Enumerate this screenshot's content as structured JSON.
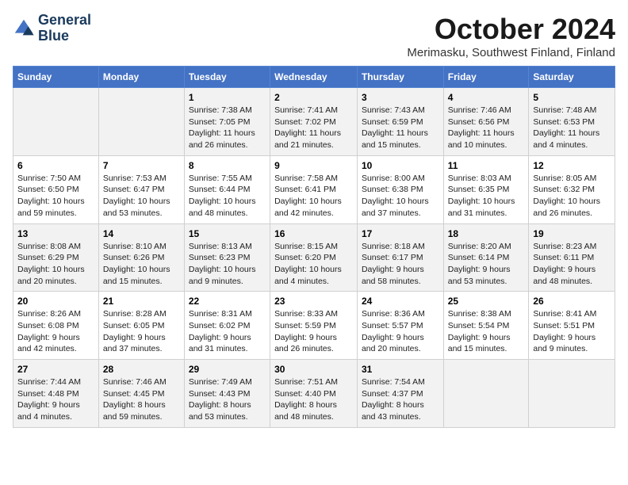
{
  "header": {
    "logo_line1": "General",
    "logo_line2": "Blue",
    "month_title": "October 2024",
    "location": "Merimasku, Southwest Finland, Finland"
  },
  "weekdays": [
    "Sunday",
    "Monday",
    "Tuesday",
    "Wednesday",
    "Thursday",
    "Friday",
    "Saturday"
  ],
  "weeks": [
    [
      {
        "day": "",
        "info": ""
      },
      {
        "day": "",
        "info": ""
      },
      {
        "day": "1",
        "info": "Sunrise: 7:38 AM\nSunset: 7:05 PM\nDaylight: 11 hours and 26 minutes."
      },
      {
        "day": "2",
        "info": "Sunrise: 7:41 AM\nSunset: 7:02 PM\nDaylight: 11 hours and 21 minutes."
      },
      {
        "day": "3",
        "info": "Sunrise: 7:43 AM\nSunset: 6:59 PM\nDaylight: 11 hours and 15 minutes."
      },
      {
        "day": "4",
        "info": "Sunrise: 7:46 AM\nSunset: 6:56 PM\nDaylight: 11 hours and 10 minutes."
      },
      {
        "day": "5",
        "info": "Sunrise: 7:48 AM\nSunset: 6:53 PM\nDaylight: 11 hours and 4 minutes."
      }
    ],
    [
      {
        "day": "6",
        "info": "Sunrise: 7:50 AM\nSunset: 6:50 PM\nDaylight: 10 hours and 59 minutes."
      },
      {
        "day": "7",
        "info": "Sunrise: 7:53 AM\nSunset: 6:47 PM\nDaylight: 10 hours and 53 minutes."
      },
      {
        "day": "8",
        "info": "Sunrise: 7:55 AM\nSunset: 6:44 PM\nDaylight: 10 hours and 48 minutes."
      },
      {
        "day": "9",
        "info": "Sunrise: 7:58 AM\nSunset: 6:41 PM\nDaylight: 10 hours and 42 minutes."
      },
      {
        "day": "10",
        "info": "Sunrise: 8:00 AM\nSunset: 6:38 PM\nDaylight: 10 hours and 37 minutes."
      },
      {
        "day": "11",
        "info": "Sunrise: 8:03 AM\nSunset: 6:35 PM\nDaylight: 10 hours and 31 minutes."
      },
      {
        "day": "12",
        "info": "Sunrise: 8:05 AM\nSunset: 6:32 PM\nDaylight: 10 hours and 26 minutes."
      }
    ],
    [
      {
        "day": "13",
        "info": "Sunrise: 8:08 AM\nSunset: 6:29 PM\nDaylight: 10 hours and 20 minutes."
      },
      {
        "day": "14",
        "info": "Sunrise: 8:10 AM\nSunset: 6:26 PM\nDaylight: 10 hours and 15 minutes."
      },
      {
        "day": "15",
        "info": "Sunrise: 8:13 AM\nSunset: 6:23 PM\nDaylight: 10 hours and 9 minutes."
      },
      {
        "day": "16",
        "info": "Sunrise: 8:15 AM\nSunset: 6:20 PM\nDaylight: 10 hours and 4 minutes."
      },
      {
        "day": "17",
        "info": "Sunrise: 8:18 AM\nSunset: 6:17 PM\nDaylight: 9 hours and 58 minutes."
      },
      {
        "day": "18",
        "info": "Sunrise: 8:20 AM\nSunset: 6:14 PM\nDaylight: 9 hours and 53 minutes."
      },
      {
        "day": "19",
        "info": "Sunrise: 8:23 AM\nSunset: 6:11 PM\nDaylight: 9 hours and 48 minutes."
      }
    ],
    [
      {
        "day": "20",
        "info": "Sunrise: 8:26 AM\nSunset: 6:08 PM\nDaylight: 9 hours and 42 minutes."
      },
      {
        "day": "21",
        "info": "Sunrise: 8:28 AM\nSunset: 6:05 PM\nDaylight: 9 hours and 37 minutes."
      },
      {
        "day": "22",
        "info": "Sunrise: 8:31 AM\nSunset: 6:02 PM\nDaylight: 9 hours and 31 minutes."
      },
      {
        "day": "23",
        "info": "Sunrise: 8:33 AM\nSunset: 5:59 PM\nDaylight: 9 hours and 26 minutes."
      },
      {
        "day": "24",
        "info": "Sunrise: 8:36 AM\nSunset: 5:57 PM\nDaylight: 9 hours and 20 minutes."
      },
      {
        "day": "25",
        "info": "Sunrise: 8:38 AM\nSunset: 5:54 PM\nDaylight: 9 hours and 15 minutes."
      },
      {
        "day": "26",
        "info": "Sunrise: 8:41 AM\nSunset: 5:51 PM\nDaylight: 9 hours and 9 minutes."
      }
    ],
    [
      {
        "day": "27",
        "info": "Sunrise: 7:44 AM\nSunset: 4:48 PM\nDaylight: 9 hours and 4 minutes."
      },
      {
        "day": "28",
        "info": "Sunrise: 7:46 AM\nSunset: 4:45 PM\nDaylight: 8 hours and 59 minutes."
      },
      {
        "day": "29",
        "info": "Sunrise: 7:49 AM\nSunset: 4:43 PM\nDaylight: 8 hours and 53 minutes."
      },
      {
        "day": "30",
        "info": "Sunrise: 7:51 AM\nSunset: 4:40 PM\nDaylight: 8 hours and 48 minutes."
      },
      {
        "day": "31",
        "info": "Sunrise: 7:54 AM\nSunset: 4:37 PM\nDaylight: 8 hours and 43 minutes."
      },
      {
        "day": "",
        "info": ""
      },
      {
        "day": "",
        "info": ""
      }
    ]
  ]
}
